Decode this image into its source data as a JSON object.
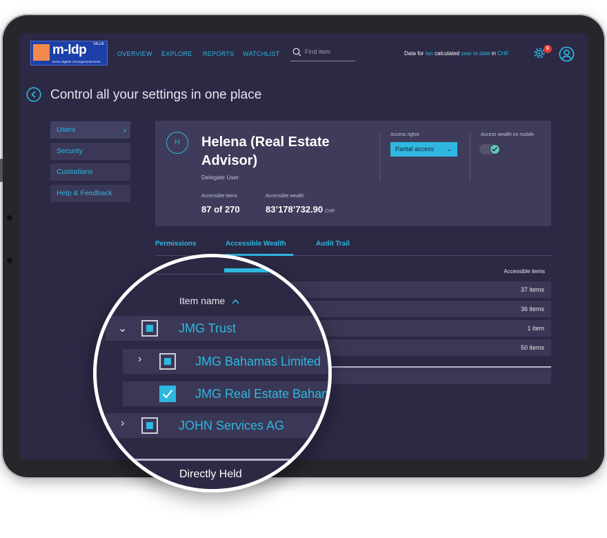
{
  "brand": {
    "name": "m-ldp",
    "superscript": "VALUE",
    "tagline": "Deine digitale Vermögensübersicht."
  },
  "nav": {
    "links": [
      "OVERVIEW",
      "EXPLORE",
      "REPORTS",
      "WATCHLIST"
    ],
    "search_placeholder": "Find item",
    "data_prefix": "Data for",
    "data_user": "Ian",
    "data_mid": "calculated",
    "data_period": "year to date",
    "data_in": "in",
    "data_currency": "CHF",
    "notification_count": "6"
  },
  "page": {
    "title": "Control all your settings in one place"
  },
  "sidebar": {
    "items": [
      {
        "label": "Users",
        "active": true
      },
      {
        "label": "Security",
        "active": false
      },
      {
        "label": "Custodians",
        "active": false
      },
      {
        "label": "Help & Feedback",
        "active": false
      }
    ]
  },
  "card": {
    "initial": "H",
    "name": "Helena (Real Estate Advisor)",
    "role": "Delegate User",
    "items_label": "Accessible items",
    "items_value": "87 of 270",
    "wealth_label": "Accessible wealth",
    "wealth_value": "83’178’732.90",
    "wealth_currency": "CHF",
    "access_label": "Access rights",
    "access_value": "Partial access",
    "mobile_label": "Access wealth on mobile",
    "mobile_enabled": true
  },
  "tabs": [
    {
      "label": "Permissions",
      "active": false
    },
    {
      "label": "Accessible Wealth",
      "active": true
    },
    {
      "label": "Audit Trail",
      "active": false
    }
  ],
  "table": {
    "column_item": "Item name",
    "column_count": "Accessible items",
    "rows": [
      {
        "name": "JMG Trust",
        "count": "37 items",
        "checked": "partial",
        "expanded": true
      },
      {
        "name": "JMG Bahamas Limited",
        "count": "36 items",
        "checked": "partial",
        "expanded": false
      },
      {
        "name": "JMG Real Estate Bahamas",
        "count": "1 item",
        "checked": "full",
        "expanded": false
      },
      {
        "name": "JOHN Services AG",
        "count": "50 items",
        "checked": "partial",
        "expanded": false
      }
    ],
    "footer_group": "Directly Held"
  },
  "colors": {
    "accent": "#2fb7e0",
    "background": "#2b2944",
    "panel": "#3e3c5a",
    "badge": "#e53935",
    "logo": "#1c3fa8",
    "logo_square": "#f28a4d"
  }
}
